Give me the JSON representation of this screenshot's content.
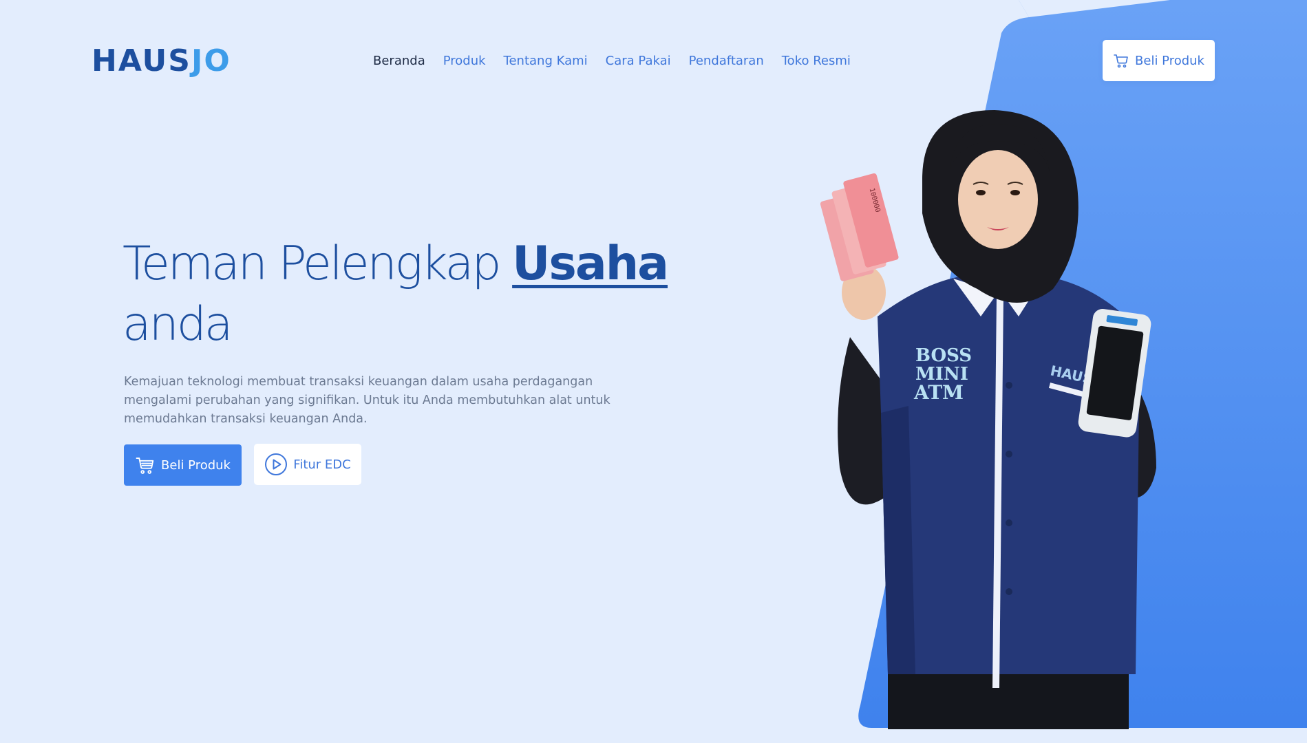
{
  "brand": {
    "logo_part1": "HAUS",
    "logo_part2": "JO",
    "primary_color": "#1d4f9f",
    "accent_color": "#3d9ce9",
    "button_color": "#3f82ed",
    "background_color": "#e3edfd"
  },
  "nav": {
    "items": [
      {
        "label": "Beranda",
        "active": true
      },
      {
        "label": "Produk",
        "active": false
      },
      {
        "label": "Tentang Kami",
        "active": false
      },
      {
        "label": "Cara Pakai",
        "active": false
      },
      {
        "label": "Pendaftaran",
        "active": false
      },
      {
        "label": "Toko Resmi",
        "active": false
      }
    ],
    "cta_label": "Beli Produk",
    "cta_icon": "cart-icon"
  },
  "hero": {
    "title_part1": "Teman Pelengkap ",
    "title_accent": "Usaha",
    "title_part2": "anda",
    "description": "Kemajuan teknologi membuat transaksi keuangan dalam usaha perdagangan mengalami perubahan yang signifikan. Untuk itu Anda membutuhkan alat untuk memudahkan transaksi keuangan Anda.",
    "primary_button": {
      "label": "Beli Produk",
      "icon": "cart-icon"
    },
    "secondary_button": {
      "label": "Fitur EDC",
      "icon": "play-circle-icon"
    }
  },
  "illustration": {
    "shirt_text_left": [
      "BOSS",
      "MINI",
      "ATM"
    ],
    "shirt_text_right": "HAUSJO",
    "banknote_text": "100000"
  }
}
